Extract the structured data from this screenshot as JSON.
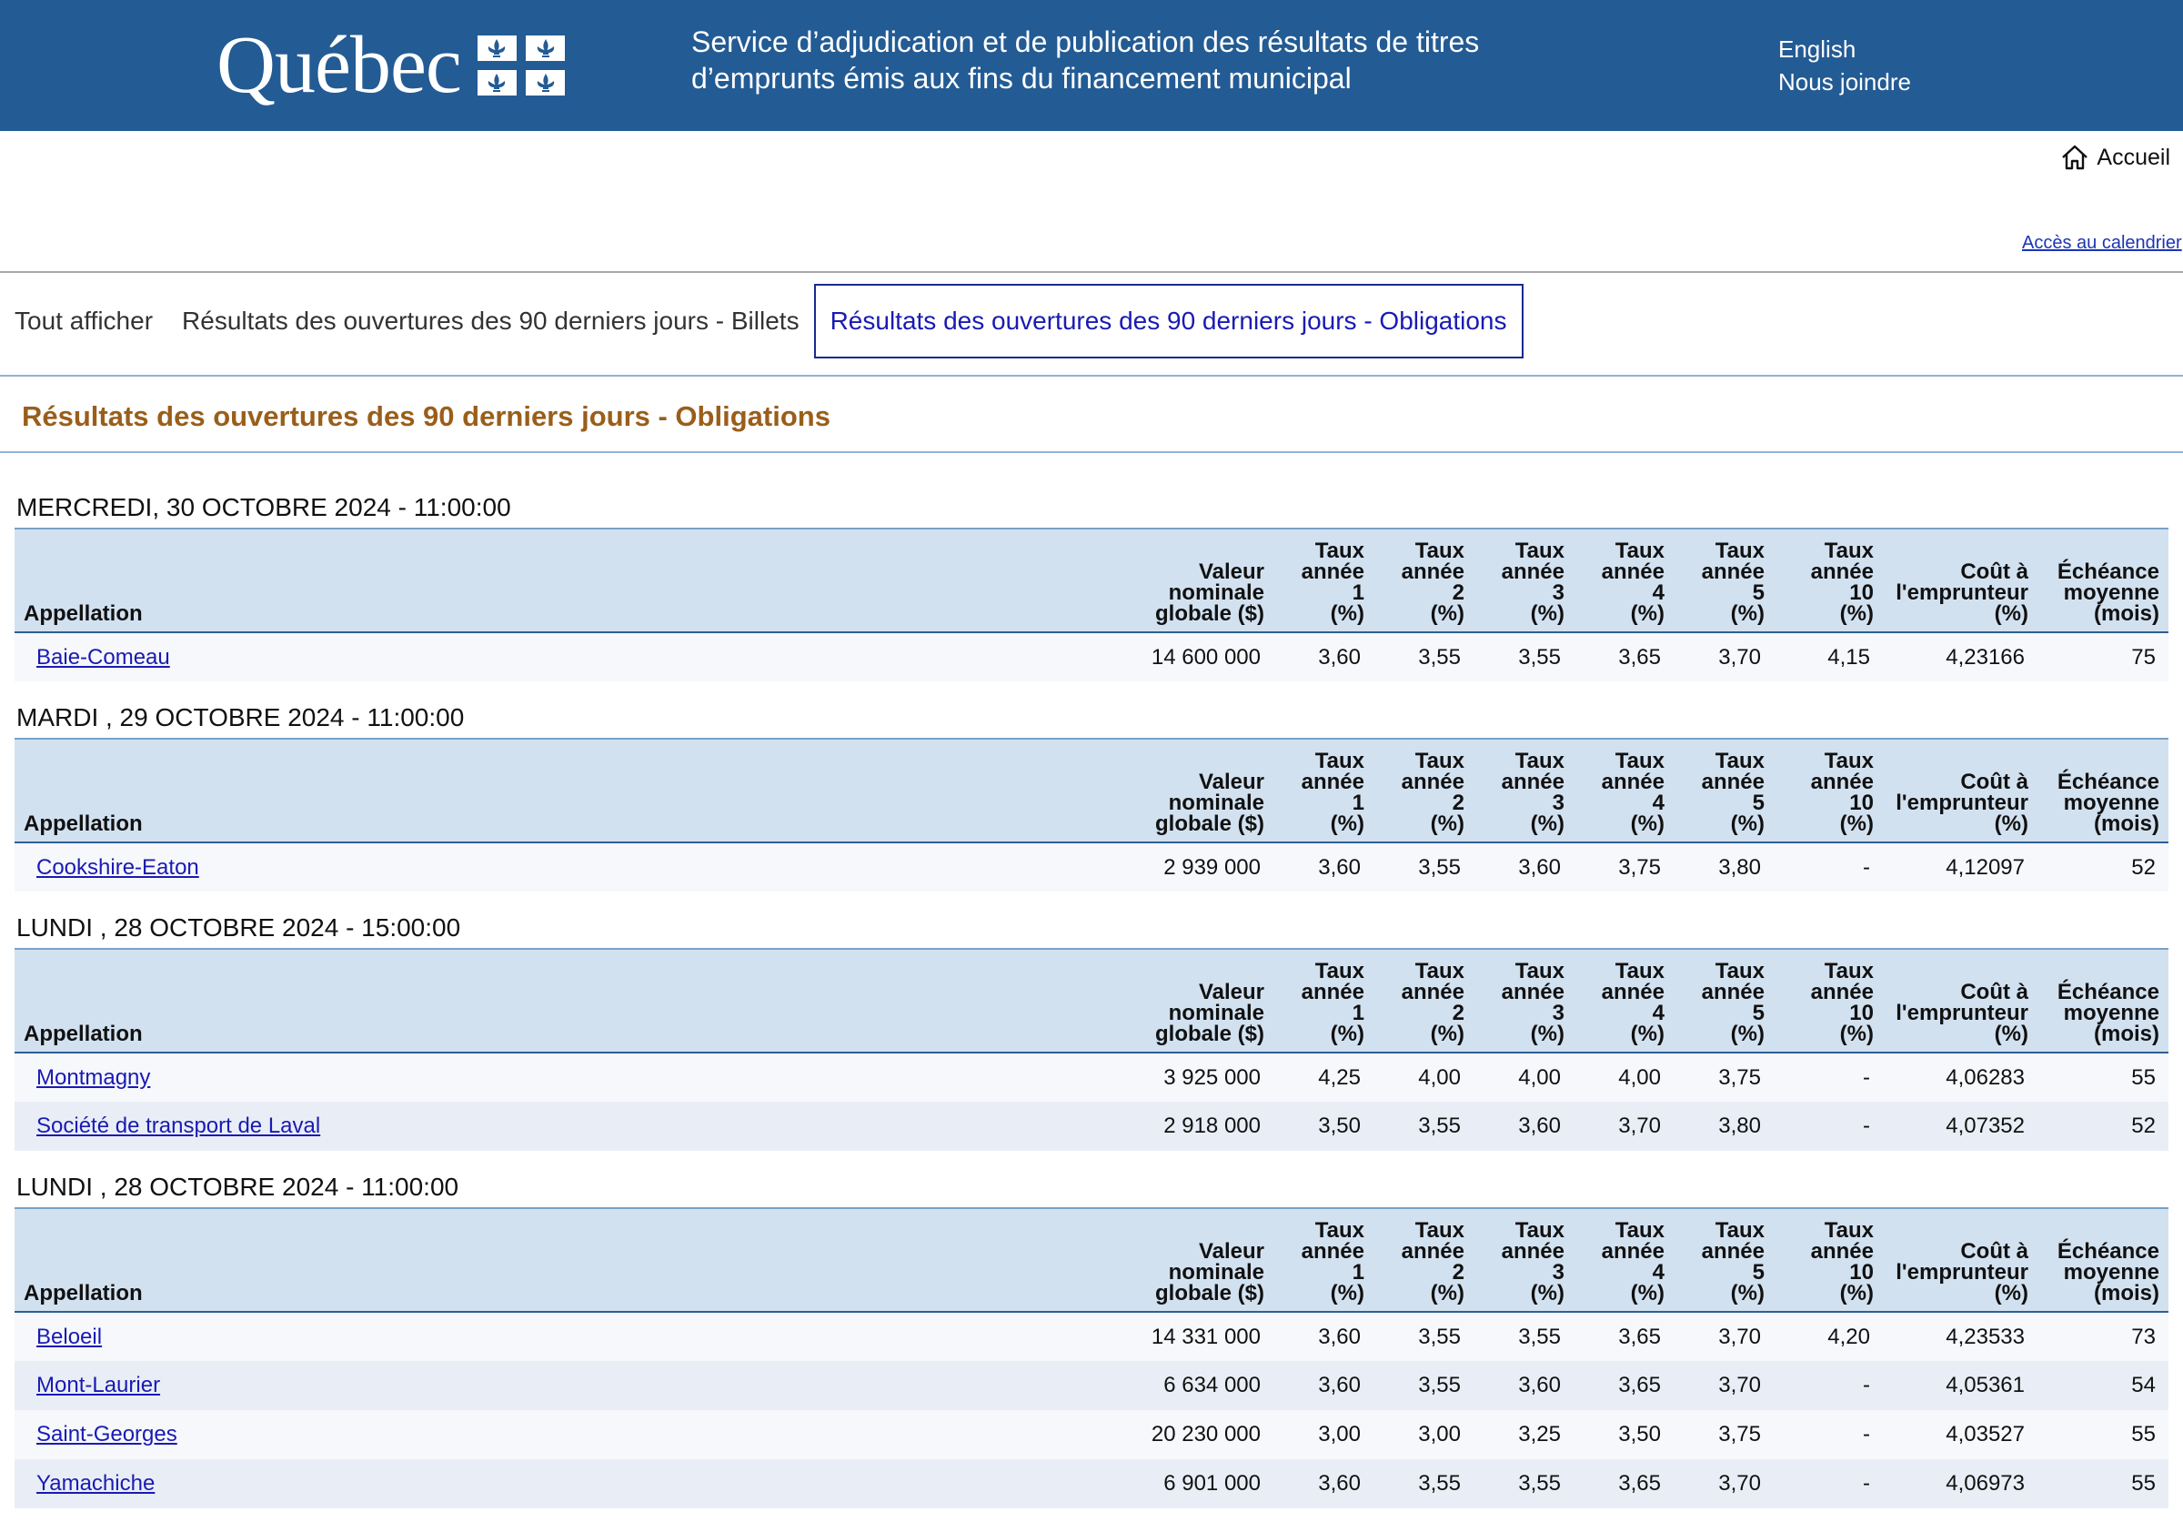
{
  "header": {
    "logo_text": "Québec",
    "service_title": "Service d’adjudication et de publication des résultats de titres d’emprunts émis aux fins du financement municipal",
    "links": [
      "English",
      "Nous joindre"
    ]
  },
  "nav": {
    "home_label": "Accueil",
    "calendar_link": "Accès au calendrier"
  },
  "tabs": [
    {
      "label": "Tout afficher",
      "active": false
    },
    {
      "label": "Résultats des ouvertures des 90 derniers jours - Billets",
      "active": false
    },
    {
      "label": "Résultats des ouvertures des 90 derniers jours - Obligations",
      "active": true
    }
  ],
  "section_title": "Résultats des ouvertures des 90 derniers jours - Obligations",
  "columns": [
    {
      "label": "Appellation"
    },
    {
      "label": "Valeur nominale globale ($)",
      "lines": [
        "Valeur",
        "nominale",
        "globale ($)"
      ]
    },
    {
      "label": "Taux année 1 (%)",
      "lines": [
        "Taux",
        "année",
        "1",
        "(%)"
      ]
    },
    {
      "label": "Taux année 2 (%)",
      "lines": [
        "Taux",
        "année",
        "2",
        "(%)"
      ]
    },
    {
      "label": "Taux année 3 (%)",
      "lines": [
        "Taux",
        "année",
        "3",
        "(%)"
      ]
    },
    {
      "label": "Taux année 4 (%)",
      "lines": [
        "Taux",
        "année",
        "4",
        "(%)"
      ]
    },
    {
      "label": "Taux année 5 (%)",
      "lines": [
        "Taux",
        "année",
        "5",
        "(%)"
      ]
    },
    {
      "label": "Taux année 10 (%)",
      "lines": [
        "Taux",
        "année",
        "10",
        "(%)"
      ]
    },
    {
      "label": "Coût à l'emprunteur (%)",
      "lines": [
        "Coût à",
        "l'emprunteur",
        "(%)"
      ]
    },
    {
      "label": "Échéance moyenne (mois)",
      "lines": [
        "Échéance",
        "moyenne",
        "(mois)"
      ]
    }
  ],
  "groups": [
    {
      "date": "MERCREDI, 30 OCTOBRE 2024 - 11:00:00",
      "rows": [
        [
          "Baie-Comeau",
          "14 600 000",
          "3,60",
          "3,55",
          "3,55",
          "3,65",
          "3,70",
          "4,15",
          "4,23166",
          "75"
        ]
      ]
    },
    {
      "date": "MARDI , 29 OCTOBRE 2024 - 11:00:00",
      "rows": [
        [
          "Cookshire-Eaton",
          "2 939 000",
          "3,60",
          "3,55",
          "3,60",
          "3,75",
          "3,80",
          "-",
          "4,12097",
          "52"
        ]
      ]
    },
    {
      "date": "LUNDI , 28 OCTOBRE 2024 - 15:00:00",
      "rows": [
        [
          "Montmagny",
          "3 925 000",
          "4,25",
          "4,00",
          "4,00",
          "4,00",
          "3,75",
          "-",
          "4,06283",
          "55"
        ],
        [
          "Société de transport de Laval",
          "2 918 000",
          "3,50",
          "3,55",
          "3,60",
          "3,70",
          "3,80",
          "-",
          "4,07352",
          "52"
        ]
      ]
    },
    {
      "date": "LUNDI , 28 OCTOBRE 2024 - 11:00:00",
      "rows": [
        [
          "Beloeil",
          "14 331 000",
          "3,60",
          "3,55",
          "3,55",
          "3,65",
          "3,70",
          "4,20",
          "4,23533",
          "73"
        ],
        [
          "Mont-Laurier",
          "6 634 000",
          "3,60",
          "3,55",
          "3,60",
          "3,65",
          "3,70",
          "-",
          "4,05361",
          "54"
        ],
        [
          "Saint-Georges",
          "20 230 000",
          "3,00",
          "3,00",
          "3,25",
          "3,50",
          "3,75",
          "-",
          "4,03527",
          "55"
        ],
        [
          "Yamachiche",
          "6 901 000",
          "3,60",
          "3,55",
          "3,55",
          "3,65",
          "3,70",
          "-",
          "4,06973",
          "55"
        ]
      ]
    }
  ],
  "colors": {
    "header_bg": "#235b94",
    "table_header_bg": "#d2e1f0",
    "section_title": "#9a5e1a",
    "link": "#1a1ab3"
  }
}
